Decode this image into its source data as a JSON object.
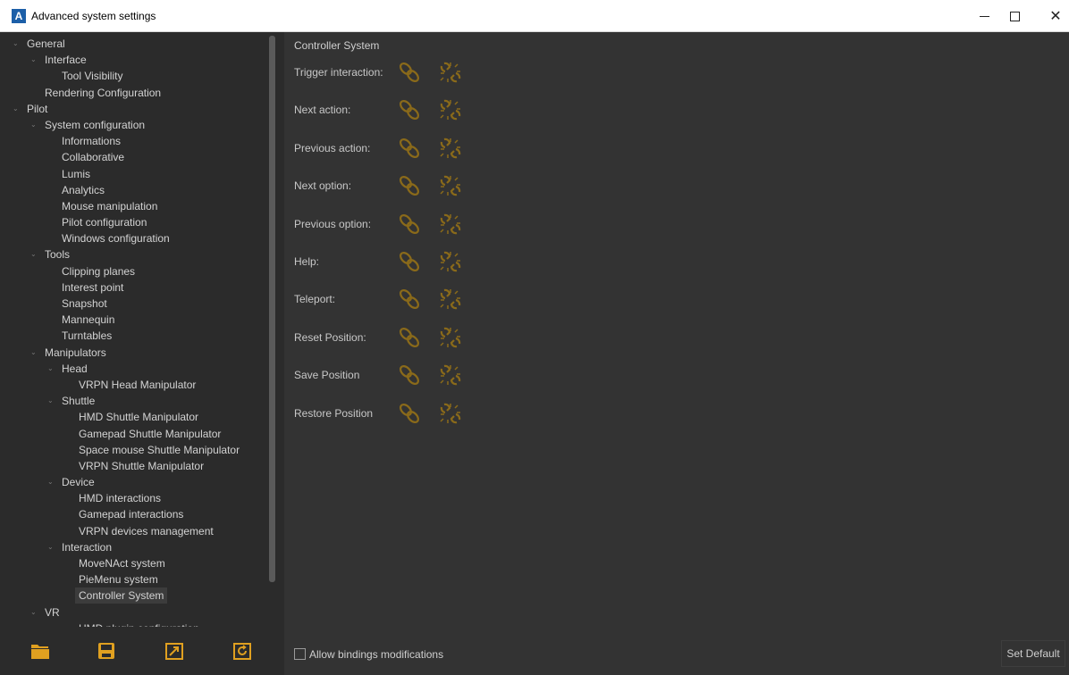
{
  "window": {
    "app_icon_letter": "A",
    "title": "Advanced system settings",
    "close_glyph": "✕"
  },
  "tree": {
    "items": [
      {
        "label": "General",
        "level": 0,
        "expanded": true
      },
      {
        "label": "Interface",
        "level": 1,
        "expanded": true
      },
      {
        "label": "Tool Visibility",
        "level": 2
      },
      {
        "label": "Rendering Configuration",
        "level": 1.5
      },
      {
        "label": "Pilot",
        "level": 0,
        "expanded": true
      },
      {
        "label": "System configuration",
        "level": 1,
        "expanded": true
      },
      {
        "label": "Informations",
        "level": 2
      },
      {
        "label": "Collaborative",
        "level": 2
      },
      {
        "label": "Lumis",
        "level": 2
      },
      {
        "label": "Analytics",
        "level": 2
      },
      {
        "label": "Mouse manipulation",
        "level": 2
      },
      {
        "label": "Pilot configuration",
        "level": 2
      },
      {
        "label": "Windows configuration",
        "level": 2
      },
      {
        "label": "Tools",
        "level": 1,
        "expanded": true
      },
      {
        "label": "Clipping planes",
        "level": 2
      },
      {
        "label": "Interest point",
        "level": 2
      },
      {
        "label": "Snapshot",
        "level": 2
      },
      {
        "label": "Mannequin",
        "level": 2
      },
      {
        "label": "Turntables",
        "level": 2
      },
      {
        "label": "Manipulators",
        "level": 1,
        "expanded": true
      },
      {
        "label": "Head",
        "level": 2,
        "expanded": true
      },
      {
        "label": "VRPN Head Manipulator",
        "level": 3
      },
      {
        "label": "Shuttle",
        "level": 2,
        "expanded": true
      },
      {
        "label": "HMD Shuttle Manipulator",
        "level": 3
      },
      {
        "label": "Gamepad Shuttle Manipulator",
        "level": 3
      },
      {
        "label": "Space mouse Shuttle Manipulator",
        "level": 3
      },
      {
        "label": "VRPN Shuttle Manipulator",
        "level": 3
      },
      {
        "label": "Device",
        "level": 2,
        "expanded": true
      },
      {
        "label": "HMD interactions",
        "level": 3
      },
      {
        "label": "Gamepad interactions",
        "level": 3
      },
      {
        "label": "VRPN devices management",
        "level": 3
      },
      {
        "label": "Interaction",
        "level": 2,
        "expanded": true
      },
      {
        "label": "MoveNAct system",
        "level": 3
      },
      {
        "label": "PieMenu system",
        "level": 3
      },
      {
        "label": "Controller System",
        "level": 3,
        "selected": true
      },
      {
        "label": "VR",
        "level": 1,
        "expanded": true
      },
      {
        "label": "HMD plugin configuration",
        "level": 3
      }
    ]
  },
  "toolbar": {
    "icons": [
      "folder-icon",
      "save-icon",
      "export-icon",
      "reset-icon"
    ]
  },
  "content": {
    "title": "Controller System",
    "bindings": [
      {
        "label": "Trigger interaction:"
      },
      {
        "label": "Next action:"
      },
      {
        "label": "Previous action:"
      },
      {
        "label": "Next option:"
      },
      {
        "label": "Previous option:"
      },
      {
        "label": "Help:"
      },
      {
        "label": "Teleport:"
      },
      {
        "label": "Reset Position:"
      },
      {
        "label": "Save Position"
      },
      {
        "label": "Restore Position"
      }
    ],
    "allow_label": "Allow bindings modifications",
    "allow_checked": false,
    "set_default_label": "Set Default"
  },
  "colors": {
    "background": "#2b2b2b",
    "content_bg": "#333333",
    "text": "#d3d3d3",
    "link_icon": "#8a6a1a",
    "toolbar_icon": "#e0a020"
  }
}
